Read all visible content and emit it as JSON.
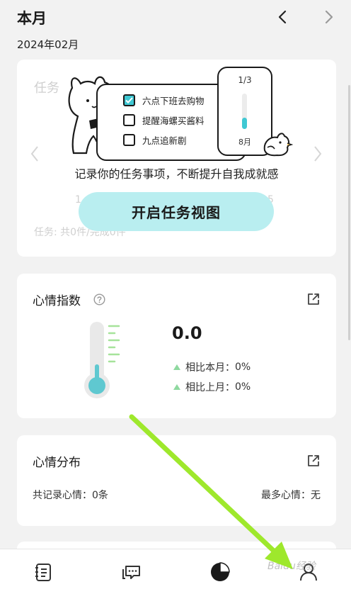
{
  "header": {
    "title": "本月",
    "month": "2024年02月",
    "prev_icon": "chevron-left-icon",
    "next_icon": "chevron-right-icon"
  },
  "task_card": {
    "title": "任务",
    "count_text": "任务: 共0件/完成0件",
    "faint_numbers": [
      "1",
      "5"
    ],
    "illustration": {
      "items": [
        {
          "label": "六点下班去购物",
          "checked": true
        },
        {
          "label": "提醒海螺买酱料",
          "checked": false
        },
        {
          "label": "九点追新剧",
          "checked": false
        }
      ],
      "phone_progress": "1/3",
      "phone_progress_value": 0.33,
      "phone_month": "8月"
    },
    "promo_text": "记录你的任务事项，不断提升自我成就感",
    "cta_label": "开启任务视图",
    "accent": "#3fc8d3",
    "cta_bg": "#b9eef0"
  },
  "mood_index": {
    "title": "心情指数",
    "value": "0.0",
    "compare_this_month_label": "相比本月：",
    "compare_this_month_value": "0%",
    "compare_last_month_label": "相比上月：",
    "compare_last_month_value": "0%",
    "help_icon": "help-circle-icon",
    "share_icon": "external-link-icon",
    "thermo_color": "#5fc8d0",
    "tick_color": "#a6e39a"
  },
  "mood_dist": {
    "title": "心情分布",
    "total_label": "共记录心情：",
    "total_value": "0条",
    "most_label": "最多心情：",
    "most_value": "无",
    "share_icon": "external-link-icon"
  },
  "bottom_nav": {
    "tabs": [
      {
        "icon": "list-icon",
        "active": false
      },
      {
        "icon": "chat-icon",
        "active": false
      },
      {
        "icon": "pie-chart-icon",
        "active": true
      },
      {
        "icon": "user-icon",
        "active": false
      }
    ]
  },
  "overlay": {
    "arrow_color": "#9ee82c",
    "watermark": "Baidu经验"
  }
}
